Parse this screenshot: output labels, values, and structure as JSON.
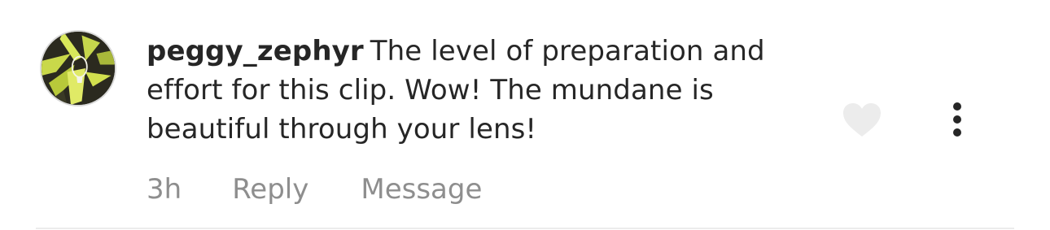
{
  "comment": {
    "username": "peggy_zephyr",
    "text": "The level of preparation and effort for this clip. Wow! The mundane is beautiful through your lens!",
    "time": "3h",
    "reply_label": "Reply",
    "message_label": "Message",
    "avatar_icon": "profile-avatar",
    "like_icon": "heart-icon",
    "more_icon": "more-vertical-icon"
  },
  "colors": {
    "text": "#262626",
    "muted": "#8e8e8e",
    "heart": "#ececec",
    "divider": "#ececec"
  }
}
